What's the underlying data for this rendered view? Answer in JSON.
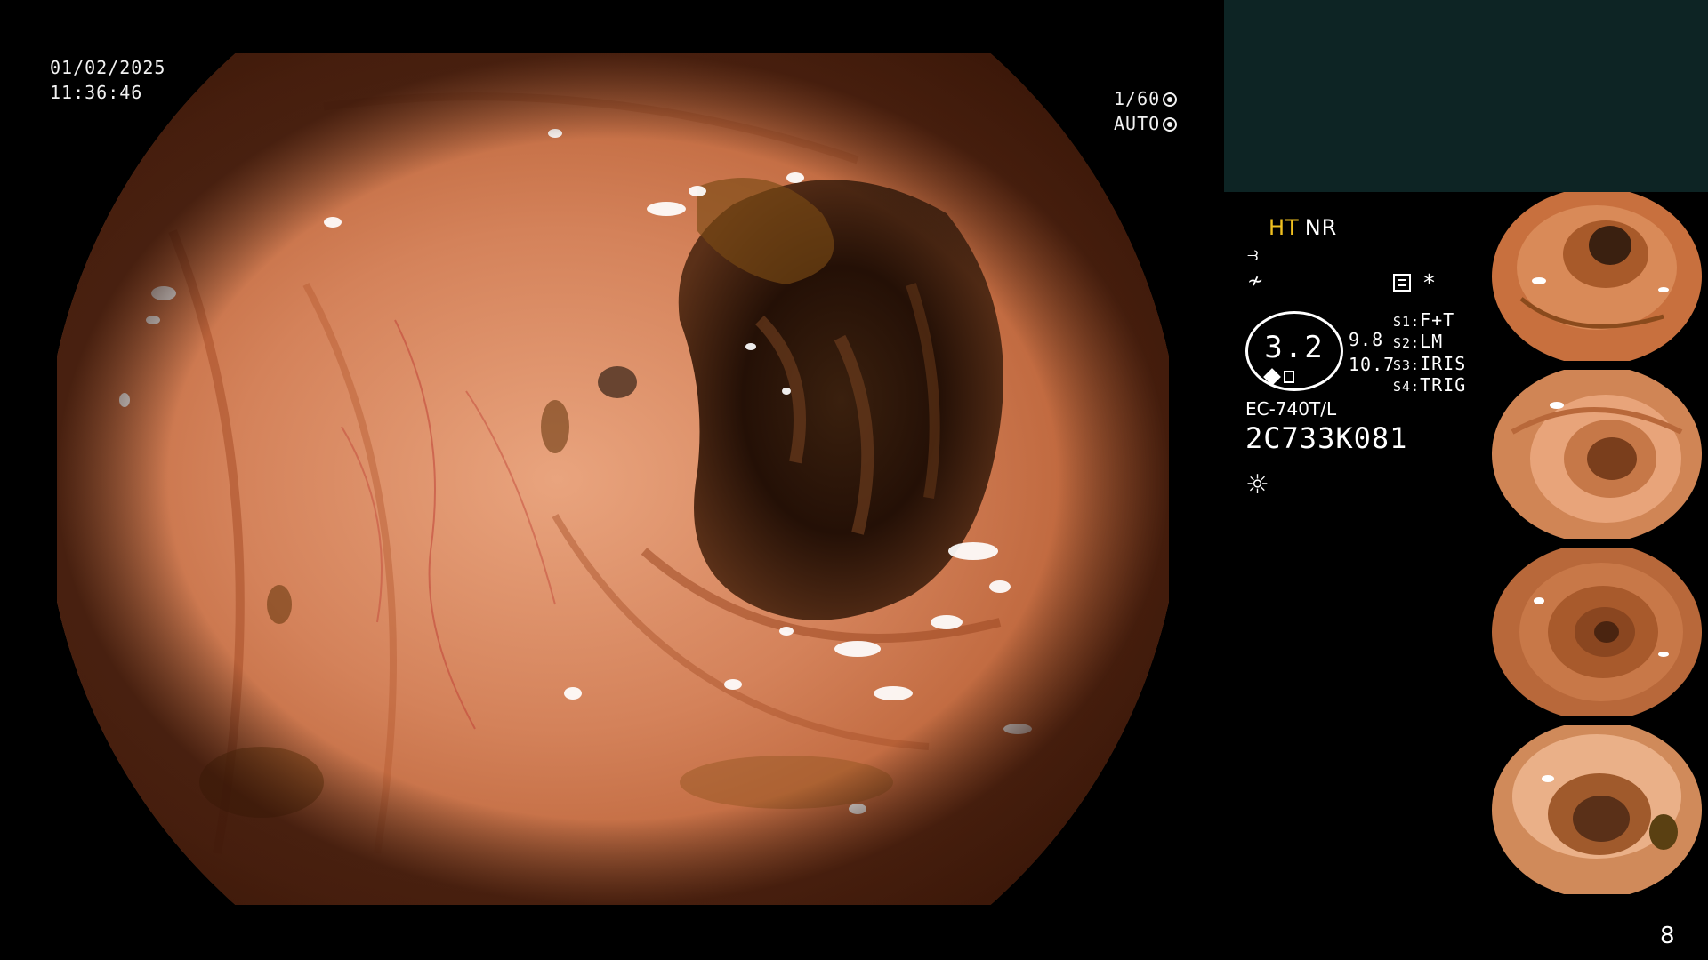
{
  "overlay": {
    "date": "01/02/2025",
    "time": "11:36:46",
    "shutter": "1/60",
    "exposure": "AUTO"
  },
  "panel": {
    "mode_ht": "HT",
    "mode_nr": "NR",
    "sym_1": "⥽",
    "sym_2": "≁",
    "star": "*",
    "gauge_value": "3.2",
    "gauge_r1": "9.8",
    "gauge_r2": "10.7",
    "switches": [
      {
        "key": "S1:",
        "value": "F+T"
      },
      {
        "key": "S2:",
        "value": "LM"
      },
      {
        "key": "S3:",
        "value": "IRIS"
      },
      {
        "key": "S4:",
        "value": "TRIG"
      }
    ],
    "scope_model": "EC-740T/L",
    "scope_serial": "2C733K081",
    "light_icon": "☼"
  },
  "page_number": "8",
  "colors": {
    "tissue_base": "#c8704a",
    "tissue_light": "#e8a57a",
    "lumen_dark": "#2a140a",
    "panel_bg": "#0d2424",
    "ht_yellow": "#f0c020"
  }
}
